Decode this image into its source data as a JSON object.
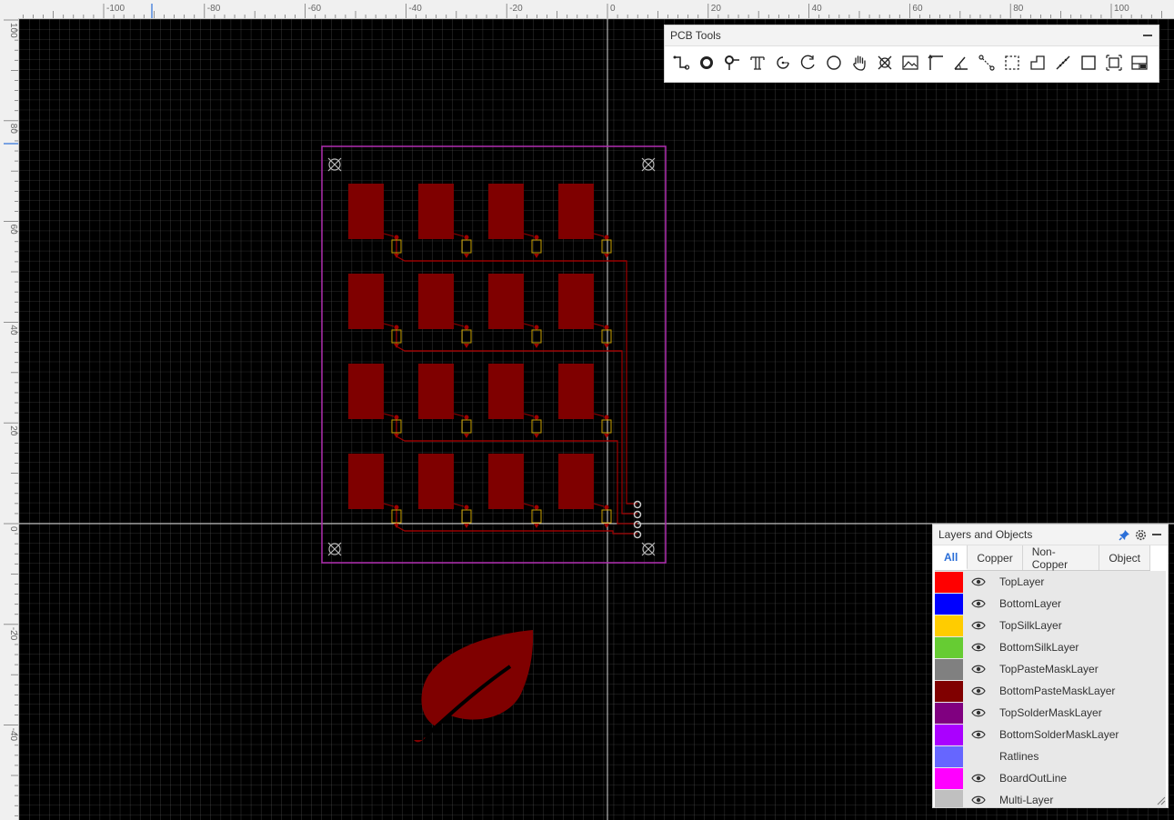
{
  "rulers": {
    "top_labels": [
      "-100",
      "-80",
      "-60",
      "-40",
      "-20",
      "0",
      "20",
      "40",
      "60",
      "80",
      "100"
    ],
    "left_labels": [
      "100",
      "80",
      "60",
      "40",
      "20",
      "0",
      "-20",
      "-40"
    ]
  },
  "pcb_tools": {
    "title": "PCB Tools",
    "tools": [
      {
        "icon": "track-icon"
      },
      {
        "icon": "pad-icon"
      },
      {
        "icon": "via-icon"
      },
      {
        "icon": "text-icon"
      },
      {
        "icon": "arc-icon"
      },
      {
        "icon": "center-arc-icon"
      },
      {
        "icon": "circle-icon"
      },
      {
        "icon": "hand-icon"
      },
      {
        "icon": "hole-icon"
      },
      {
        "icon": "image-icon"
      },
      {
        "icon": "dimension-icon"
      },
      {
        "icon": "angle-icon"
      },
      {
        "icon": "connect-pad-icon"
      },
      {
        "icon": "rect-select-icon"
      },
      {
        "icon": "copper-area-icon"
      },
      {
        "icon": "measure-icon"
      },
      {
        "icon": "rectangle-icon"
      },
      {
        "icon": "group-icon"
      },
      {
        "icon": "panel-icon"
      }
    ]
  },
  "layers_panel": {
    "title": "Layers and Objects",
    "tabs": [
      "All",
      "Copper",
      "Non-Copper",
      "Object"
    ],
    "active_tab": "All",
    "layers": [
      {
        "name": "TopLayer",
        "color": "#ff0000",
        "visible": true
      },
      {
        "name": "BottomLayer",
        "color": "#0000ff",
        "visible": true
      },
      {
        "name": "TopSilkLayer",
        "color": "#ffcc00",
        "visible": true
      },
      {
        "name": "BottomSilkLayer",
        "color": "#66cc33",
        "visible": true
      },
      {
        "name": "TopPasteMaskLayer",
        "color": "#808080",
        "visible": true
      },
      {
        "name": "BottomPasteMaskLayer",
        "color": "#800000",
        "visible": true
      },
      {
        "name": "TopSolderMaskLayer",
        "color": "#800080",
        "visible": true
      },
      {
        "name": "BottomSolderMaskLayer",
        "color": "#aa00ff",
        "visible": true
      },
      {
        "name": "Ratlines",
        "color": "#6666ff",
        "visible": false
      },
      {
        "name": "BoardOutLine",
        "color": "#ff00ff",
        "visible": true
      },
      {
        "name": "Multi-Layer",
        "color": "#c0c0c0",
        "visible": true
      }
    ]
  }
}
